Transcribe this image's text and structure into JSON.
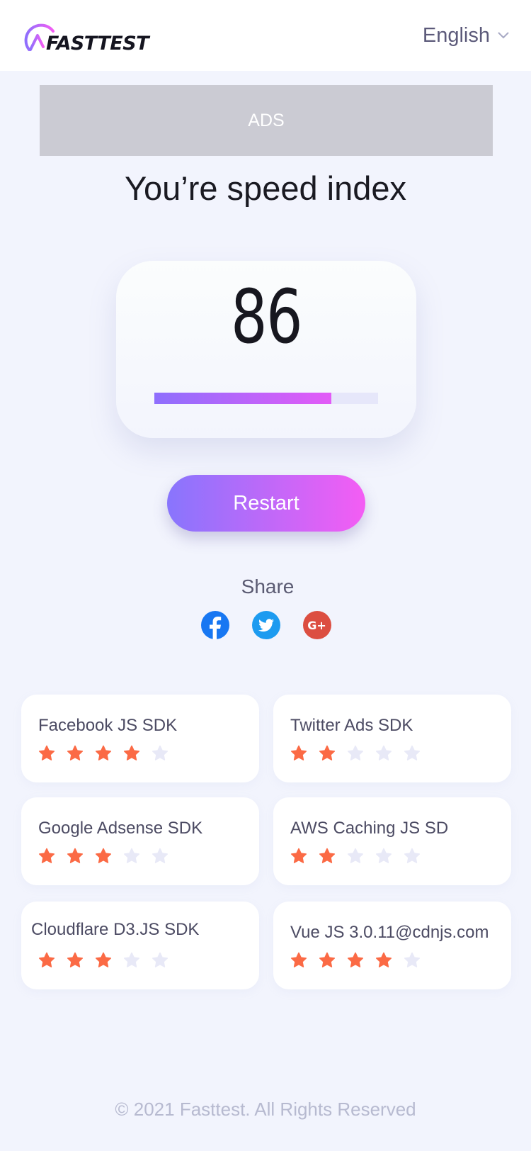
{
  "header": {
    "logo_text": "FASTTEST",
    "language": "English"
  },
  "ads": {
    "label": "ADS"
  },
  "result": {
    "title": "You’re speed index",
    "score": "86",
    "progress_fraction": 0.79
  },
  "restart_label": "Restart",
  "share": {
    "label": "Share",
    "icons": [
      "facebook-icon",
      "twitter-icon",
      "google-plus-icon"
    ]
  },
  "colors": {
    "star_filled": "#fb6a45",
    "star_empty": "#e8e9f7",
    "accent_start": "#8875fd",
    "accent_end": "#f45df4"
  },
  "sdks": [
    {
      "name": "Facebook JS SDK",
      "rating": 4
    },
    {
      "name": "Twitter Ads SDK",
      "rating": 2
    },
    {
      "name": "Google Adsense SDK",
      "rating": 3
    },
    {
      "name": "AWS Caching JS SD",
      "rating": 2
    },
    {
      "name": "Cloudflare D3.JS SDK",
      "rating": 3
    },
    {
      "name": "Vue JS 3.0.11@cdnjs.com",
      "rating": 4
    }
  ],
  "footer": "© 2021 Fasttest. All Rights Reserved"
}
